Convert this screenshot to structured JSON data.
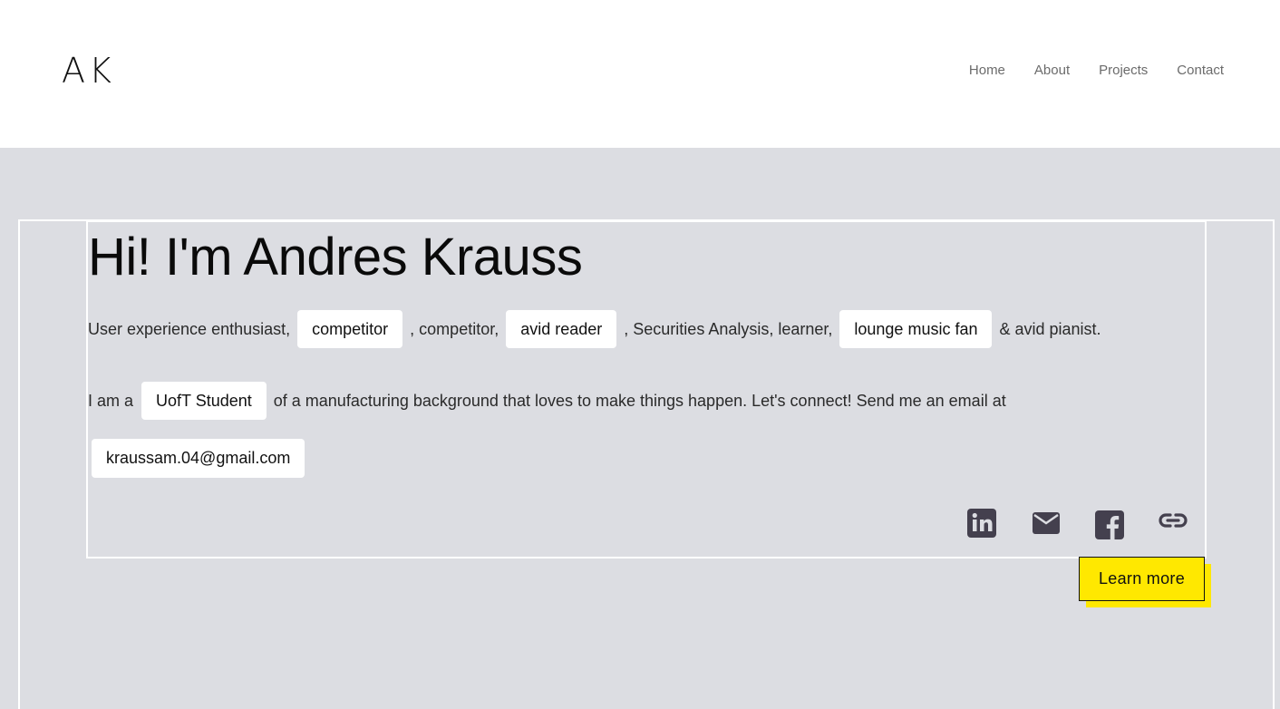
{
  "header": {
    "logo": "AK",
    "nav": [
      {
        "label": "Home"
      },
      {
        "label": "About"
      },
      {
        "label": "Projects"
      },
      {
        "label": "Contact"
      }
    ]
  },
  "hero": {
    "title": "Hi! I'm Andres Krauss",
    "line1": {
      "t1": "User experience enthusiast,",
      "chip1": "competitor",
      "t2": ", competitor,",
      "chip2": "avid reader",
      "t3": ", Securities Analysis, learner,",
      "chip3": "lounge music fan",
      "t4": "& avid pianist."
    },
    "line2": {
      "t1": "I am a",
      "chip1": "UofT Student",
      "t2": "of a manufacturing background that loves to make things happen. Let's connect! Send me an email at"
    },
    "email": "kraussam.04@gmail.com",
    "social_icons": [
      "linkedin-icon",
      "mail-icon",
      "facebook-icon",
      "link-icon"
    ],
    "learn_more": "Learn more"
  },
  "colors": {
    "hero_background": "#dcdde2",
    "accent_yellow": "#ffe800",
    "icon_color": "#44404e",
    "nav_text": "#6b6b6b"
  }
}
